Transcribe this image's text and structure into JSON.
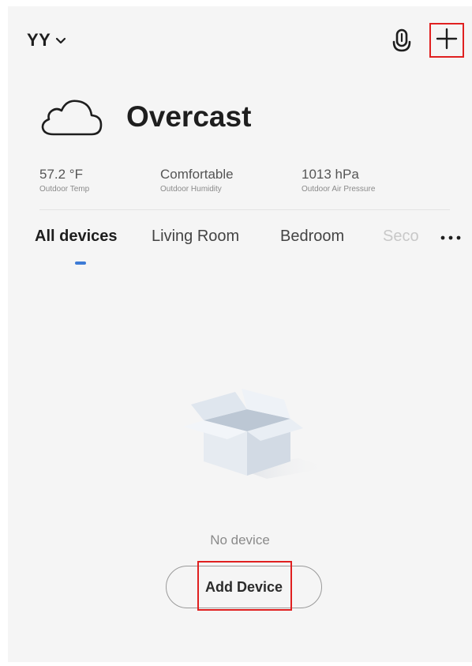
{
  "header": {
    "home_name": "YY",
    "mic_icon": "microphone-icon",
    "add_icon": "plus-icon"
  },
  "weather": {
    "condition": "Overcast",
    "icon": "cloud-icon",
    "stats": [
      {
        "value": "57.2 °F",
        "label": "Outdoor Temp"
      },
      {
        "value": "Comfortable",
        "label": "Outdoor Humidity"
      },
      {
        "value": "1013 hPa",
        "label": "Outdoor Air Pressure"
      }
    ]
  },
  "tabs": [
    {
      "label": "All devices",
      "active": true
    },
    {
      "label": "Living Room",
      "active": false
    },
    {
      "label": "Bedroom",
      "active": false
    },
    {
      "label": "Seco",
      "active": false
    }
  ],
  "more_icon": "more-icon",
  "empty_state": {
    "icon": "empty-box-icon",
    "message": "No device",
    "button_label": "Add Device"
  },
  "colors": {
    "accent": "#3d7bd6",
    "highlight": "#e02020",
    "background": "#f5f5f5"
  }
}
